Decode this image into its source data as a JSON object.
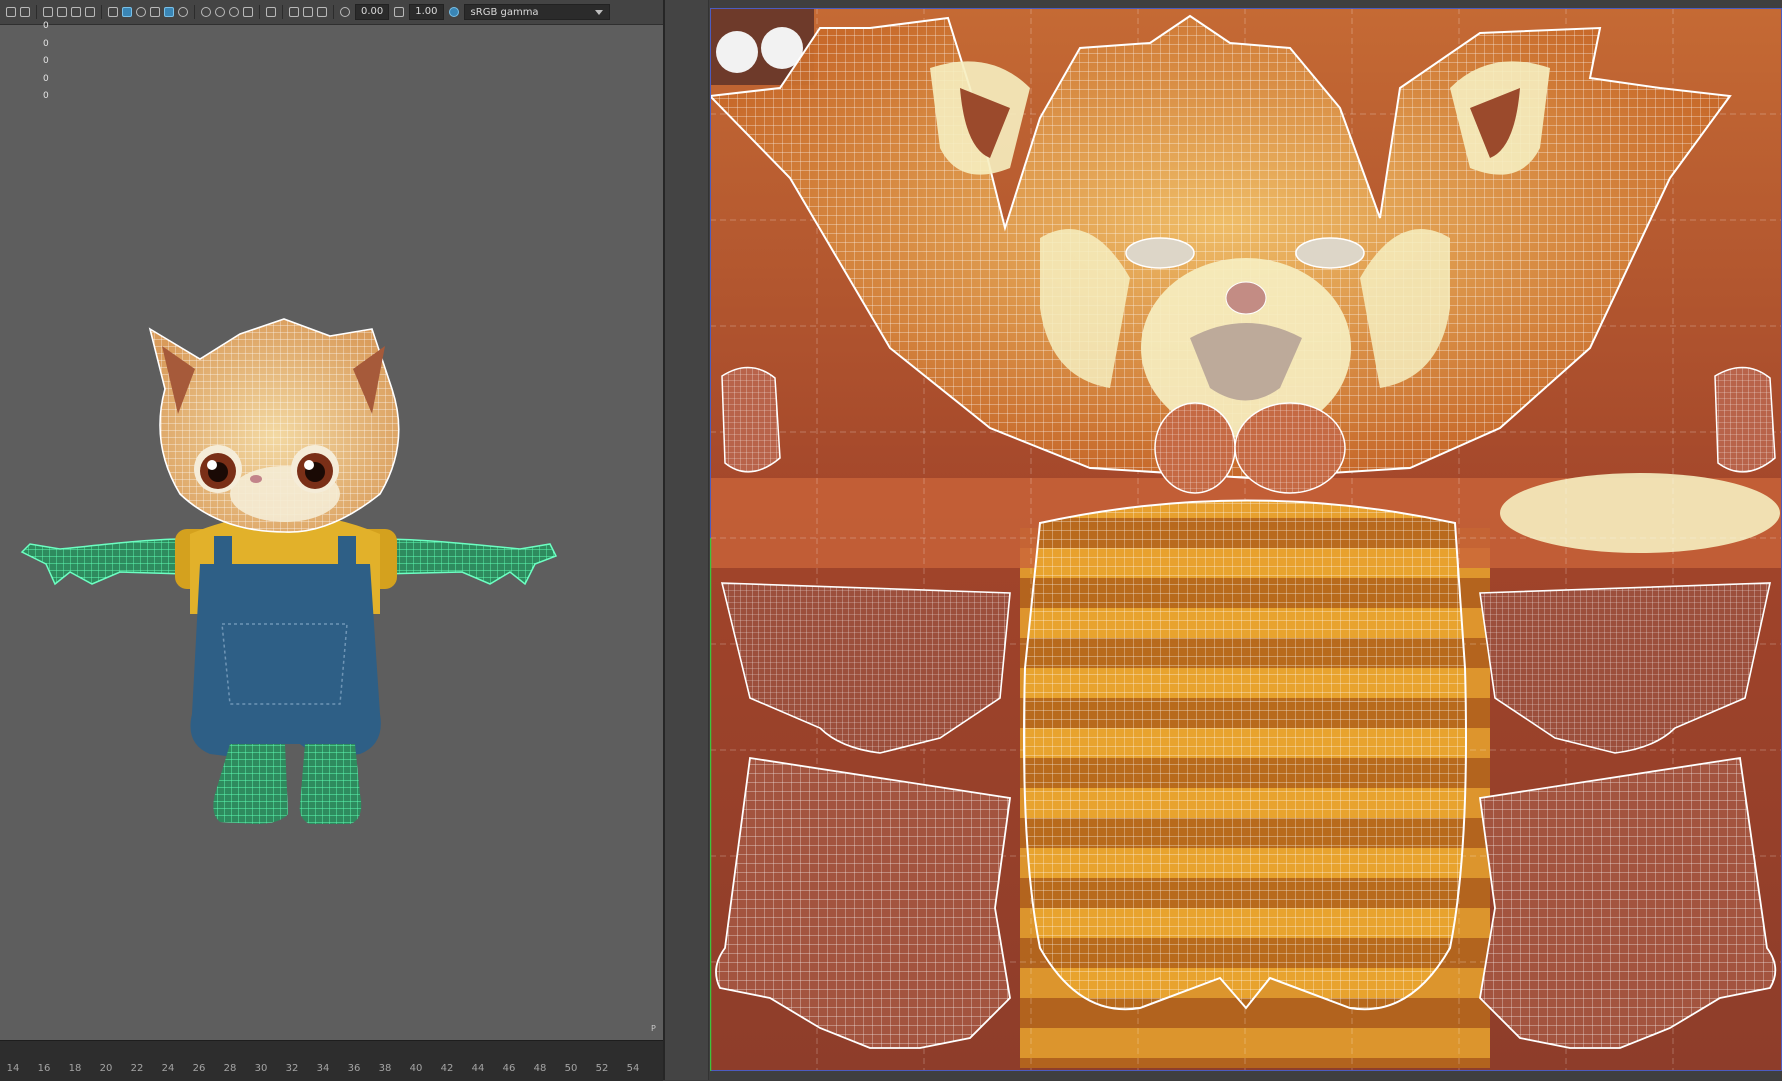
{
  "toolbar": {
    "field_exposure": "0.00",
    "field_gamma": "1.00",
    "colorspace": "sRGB gamma"
  },
  "hud": {
    "values": [
      "0",
      "0",
      "0",
      "0",
      "0"
    ]
  },
  "timeline": {
    "ticks": [
      "14",
      "16",
      "18",
      "20",
      "22",
      "24",
      "26",
      "28",
      "30",
      "32",
      "34",
      "36",
      "38",
      "40",
      "42",
      "44",
      "46",
      "48",
      "50",
      "52",
      "54"
    ],
    "corner_label": "P"
  },
  "icons": {
    "toolbar_icons": [
      "camera-icon",
      "grid-icon",
      "film-gate-icon",
      "resolution-gate-icon",
      "wireframe-icon",
      "smooth-shade-icon",
      "textured-icon",
      "xray-icon",
      "light-icon",
      "shadow-icon",
      "ambient-occlusion-icon",
      "motion-blur-icon",
      "antialias-icon",
      "isolate-icon",
      "xray-joints-icon",
      "camera-attr-icon",
      "exposure-icon",
      "gamma-icon",
      "color-management-icon"
    ]
  },
  "colors": {
    "viewport_bg": "#5e5e5e",
    "uv_bg": "#3f3f3f",
    "selection_green": "#4be6a2",
    "wire_white": "#ffffff",
    "fur_orange": "#c8672d",
    "fur_cream": "#f6eec0"
  }
}
